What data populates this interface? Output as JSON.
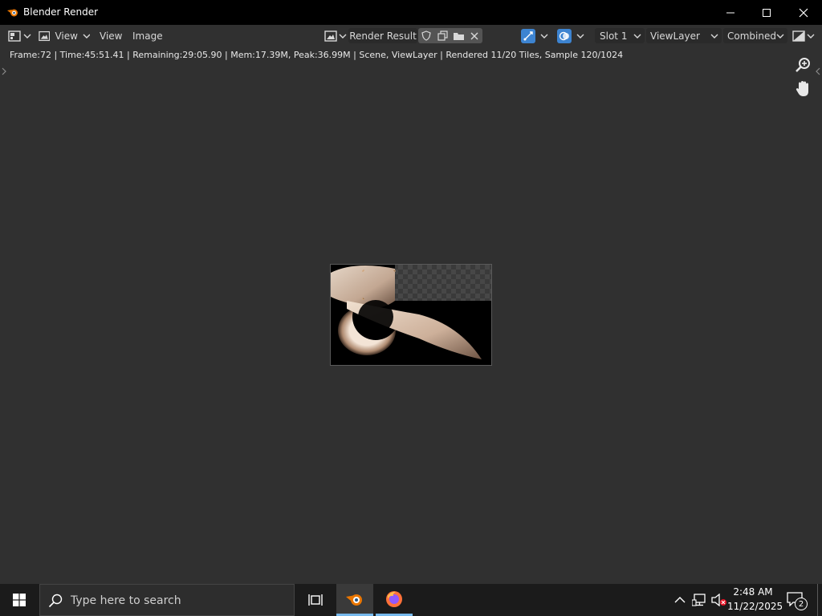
{
  "window": {
    "title": "Blender Render",
    "controls": [
      "minimize",
      "maximize",
      "close"
    ]
  },
  "toolbar": {
    "editor_type_icon": "image-editor-icon",
    "view_label": "View",
    "view_menu": "View",
    "image_menu": "Image",
    "image_name": "Render Result",
    "slot": "Slot 1",
    "view_layer": "ViewLayer",
    "pass": "Combined"
  },
  "status": {
    "text": "Frame:72 | Time:45:51.41 | Remaining:29:05.90 | Mem:17.39M, Peak:36.99M | Scene, ViewLayer | Rendered 11/20 Tiles, Sample 120/1024"
  },
  "taskbar": {
    "search_placeholder": "Type here to search",
    "time": "2:48 AM",
    "date": "11/22/2025",
    "notification_count": "2"
  },
  "colors": {
    "bg": "#303030",
    "titlebar": "#000000",
    "taskbar": "#1b1b1b",
    "accent_blue": "#3d84d1",
    "render_tone": "#e8d6c6"
  }
}
